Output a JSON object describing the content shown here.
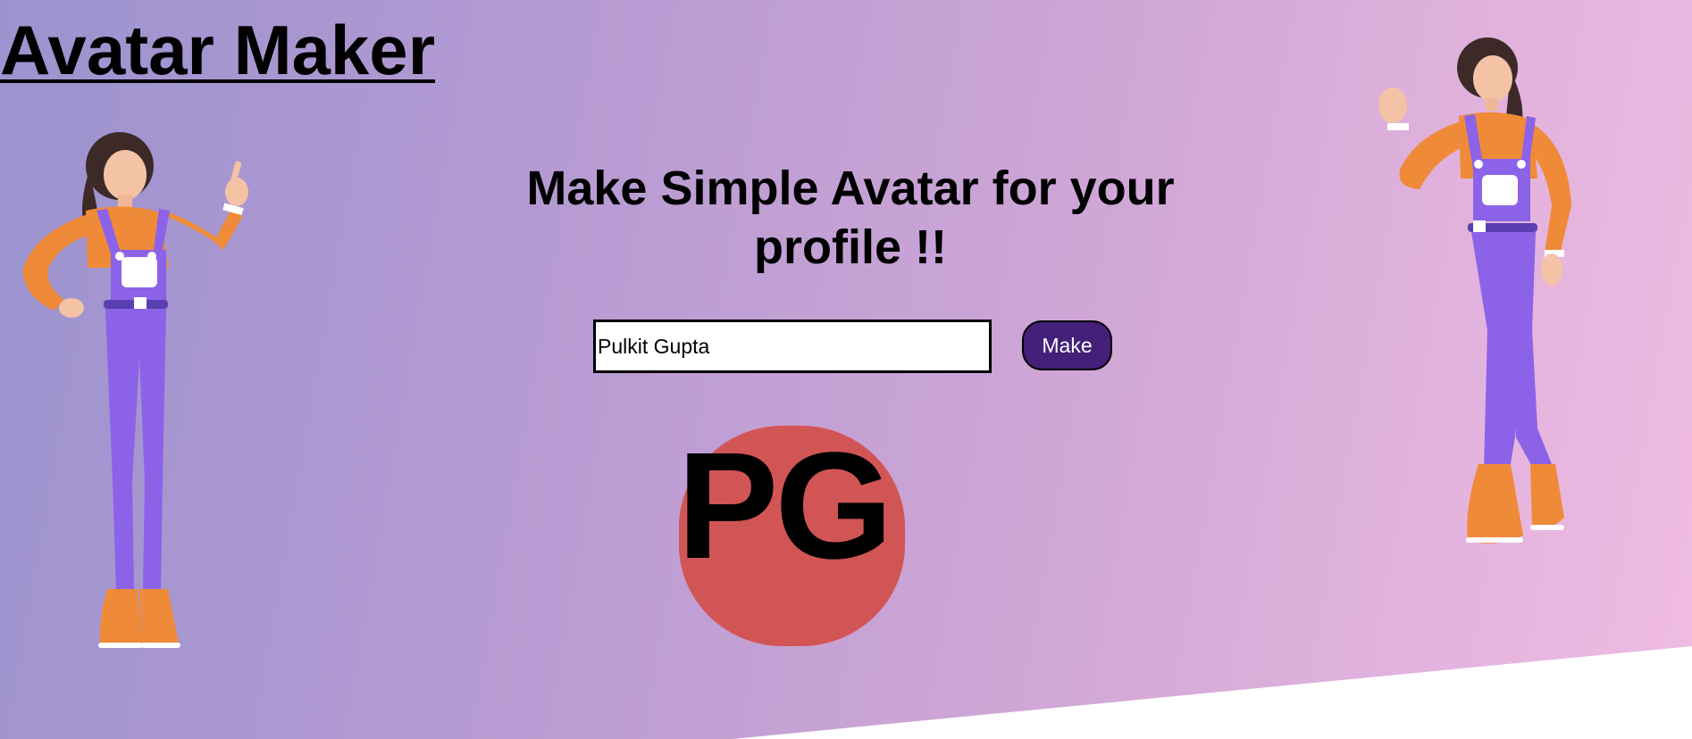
{
  "header": {
    "title": "Avatar Maker"
  },
  "main": {
    "heading": "Make Simple Avatar for your profile !!",
    "name_input": {
      "value": "Pulkit Gupta"
    },
    "make_button": {
      "label": "Make"
    },
    "avatar": {
      "initials": "PG",
      "background_color": "#d25555"
    }
  },
  "theme": {
    "button_color": "#44207a",
    "gradient": [
      "#9b93cf",
      "#f0bce2"
    ]
  },
  "decorations": {
    "left_figure_icon": "pointing-woman-illustration",
    "right_figure_icon": "waving-woman-illustration"
  }
}
